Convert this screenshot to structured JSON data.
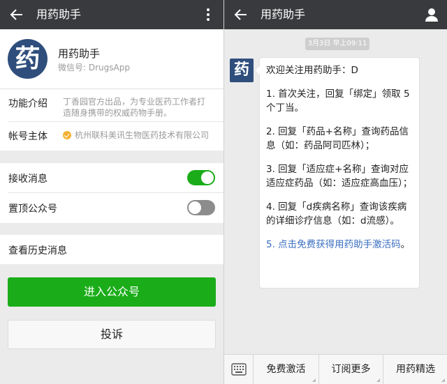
{
  "left": {
    "title": "用药助手",
    "account": {
      "avatar_char": "药",
      "name": "用药助手",
      "wechat_id": "微信号: DrugsApp"
    },
    "info": {
      "intro_label": "功能介绍",
      "intro_line1": "丁香园官方出品，为专业医药工作者打",
      "intro_line2": "造随身携带的权威药物手册。",
      "owner_label": "帐号主体",
      "owner_value": "杭州联科美讯生物医药技术有限公司"
    },
    "settings": {
      "receive_label": "接收消息",
      "receive_on": true,
      "pin_label": "置顶公众号",
      "pin_on": false
    },
    "history_label": "查看历史消息",
    "enter_button": "进入公众号",
    "complain_button": "投诉",
    "colors": {
      "green": "#1aad19",
      "topbar": "#393a3e",
      "brand": "#2f4e7c"
    }
  },
  "right": {
    "title": "用药助手",
    "timestamp": "3月3日 早上09:11",
    "avatar_char": "药",
    "message": {
      "p0": "欢迎关注用药助手：D",
      "p1": "1. 首次关注，回复「绑定」领取 5 个丁当。",
      "p2": "2. 回复「药品+名称」查询药品信息（如：药品阿司匹林）；",
      "p3": "3. 回复「适应症+名称」查询对应适应症药品（如：适应症高血压）；",
      "p4": "4. 回复「d疾病名称」查询该疾病的详细诊疗信息（如：d流感）。",
      "p5_prefix": "5. ",
      "p5_link": "点击免费获得用药助手激活码",
      "p5_suffix": "。"
    },
    "menu": [
      "免费激活",
      "订阅更多",
      "用药精选"
    ]
  },
  "icons": [
    "back-arrow-icon",
    "more-vertical-icon",
    "person-icon",
    "verified-icon",
    "keyboard-icon"
  ]
}
